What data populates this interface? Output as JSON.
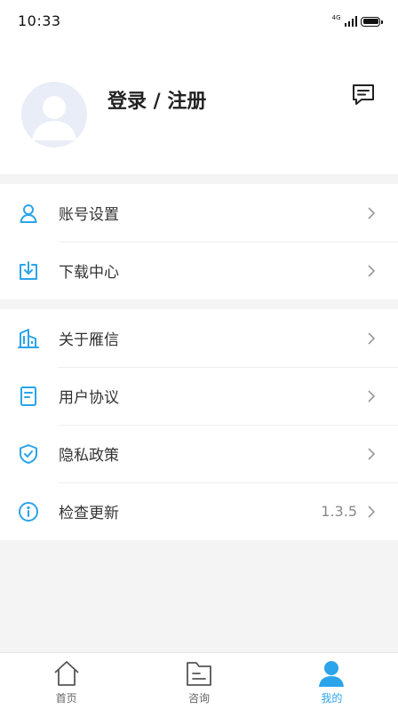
{
  "status_bar": {
    "time": "10:33",
    "network": "4G"
  },
  "profile": {
    "login_label": "登录 / 注册",
    "avatar_icon": "default-avatar-icon",
    "message_icon": "message-icon"
  },
  "menu_groups": [
    {
      "items": [
        {
          "label": "账号设置",
          "icon": "user-icon"
        },
        {
          "label": "下载中心",
          "icon": "download-icon"
        }
      ]
    },
    {
      "items": [
        {
          "label": "关于雁信",
          "icon": "building-icon"
        },
        {
          "label": "用户协议",
          "icon": "document-icon"
        },
        {
          "label": "隐私政策",
          "icon": "shield-check-icon"
        },
        {
          "label": "检查更新",
          "icon": "info-icon",
          "value": "1.3.5"
        }
      ]
    }
  ],
  "tabbar": {
    "tabs": [
      {
        "label": "首页",
        "icon": "home-icon",
        "active": false
      },
      {
        "label": "咨询",
        "icon": "folder-doc-icon",
        "active": false
      },
      {
        "label": "我的",
        "icon": "person-icon",
        "active": true
      }
    ]
  },
  "colors": {
    "accent": "#2ba4ea",
    "background": "#f4f4f4",
    "text": "#333333",
    "muted": "#888888"
  }
}
